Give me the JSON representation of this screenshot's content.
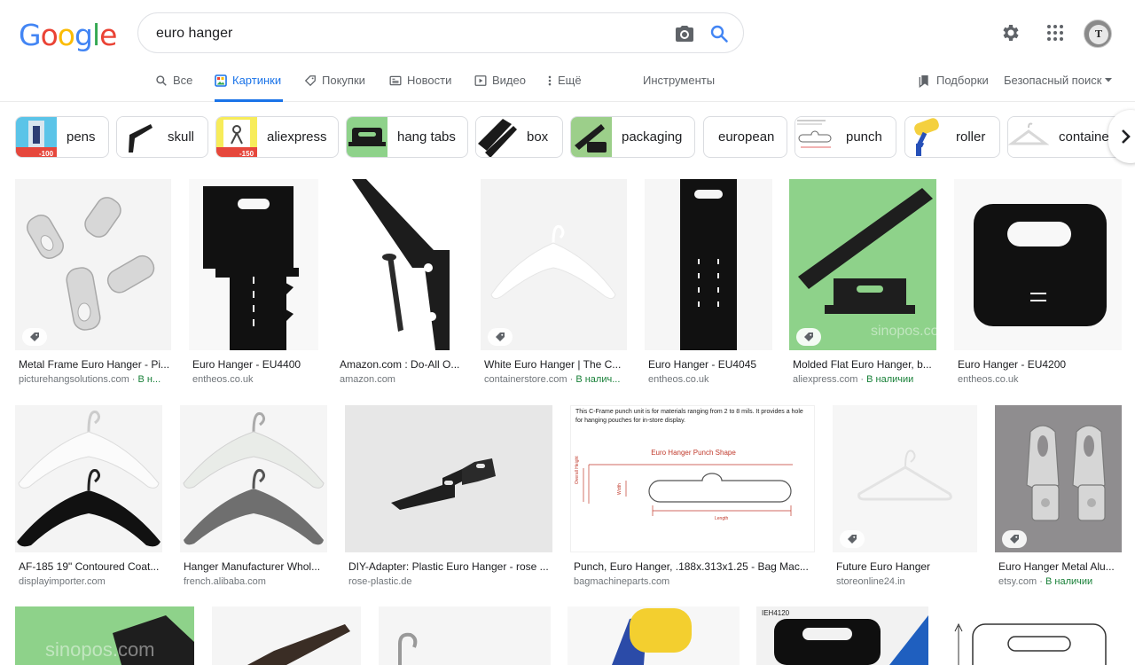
{
  "search": {
    "query": "euro hanger"
  },
  "logo": {
    "text": "Google",
    "colors": [
      "#4285F4",
      "#EA4335",
      "#FBBC05",
      "#4285F4",
      "#34A853",
      "#EA4335"
    ]
  },
  "tabs": [
    {
      "label": "Все",
      "icon": "search-icon"
    },
    {
      "label": "Картинки",
      "icon": "image-icon",
      "active": true
    },
    {
      "label": "Покупки",
      "icon": "tag-icon"
    },
    {
      "label": "Новости",
      "icon": "news-icon"
    },
    {
      "label": "Видео",
      "icon": "play-icon"
    },
    {
      "label": "Ещё",
      "icon": "more-vert-icon"
    }
  ],
  "tools_label": "Инструменты",
  "collections_label": "Подборки",
  "safe_search_label": "Безопасный поиск",
  "chips": [
    {
      "label": "pens",
      "thumb_badge": "-100"
    },
    {
      "label": "skull"
    },
    {
      "label": "aliexpress",
      "thumb_badge": "-150"
    },
    {
      "label": "hang tabs"
    },
    {
      "label": "box"
    },
    {
      "label": "packaging"
    },
    {
      "label": "european"
    },
    {
      "label": "punch"
    },
    {
      "label": "roller"
    },
    {
      "label": "containe"
    }
  ],
  "results": [
    {
      "title": "Metal Frame Euro Hanger - Pi...",
      "source": "picturehangsolutions.com · ",
      "stock": "В н...",
      "tag": true
    },
    {
      "title": "Euro Hanger - EU4400",
      "source": "entheos.co.uk"
    },
    {
      "title": "Amazon.com : Do-All O...",
      "source": "amazon.com"
    },
    {
      "title": "White Euro Hanger | The C...",
      "source": "containerstore.com · ",
      "stock": "В налич...",
      "tag": true
    },
    {
      "title": "Euro Hanger - EU4045",
      "source": "entheos.co.uk"
    },
    {
      "title": "Molded Flat Euro Hanger, b...",
      "source": "aliexpress.com · ",
      "stock": "В наличии",
      "tag": true
    },
    {
      "title": "Euro Hanger - EU4200",
      "source": "entheos.co.uk"
    },
    {
      "title": "AF-185 19\" Contoured Coat...",
      "source": "displayimporter.com"
    },
    {
      "title": "Hanger Manufacturer Whol...",
      "source": "french.alibaba.com"
    },
    {
      "title": "DIY-Adapter: Plastic Euro Hanger - rose ...",
      "source": "rose-plastic.de"
    },
    {
      "title": "Punch, Euro Hanger, .188x.313x1.25 - Bag Mac...",
      "source": "bagmachineparts.com"
    },
    {
      "title": "Future Euro Hanger",
      "source": "storeonline24.in",
      "tag": true
    },
    {
      "title": "Euro Hanger Metal Alu...",
      "source": "etsy.com · ",
      "stock": "В наличии",
      "tag": true
    }
  ],
  "punch_image": {
    "caption": "This C-Frame punch unit is for materials ranging from 2 to 8  mils. It provides a hole for hanging pouches for in-store display.",
    "heading": "Euro Hanger Punch Shape",
    "overall_height": "Overall Height",
    "width": "Width",
    "length": "Length"
  },
  "watermark": "sinopos.com",
  "bottom_label": "IEH4120",
  "colors": {
    "accent": "#1a73e8",
    "stock": "#188038",
    "source": "#70757a"
  }
}
